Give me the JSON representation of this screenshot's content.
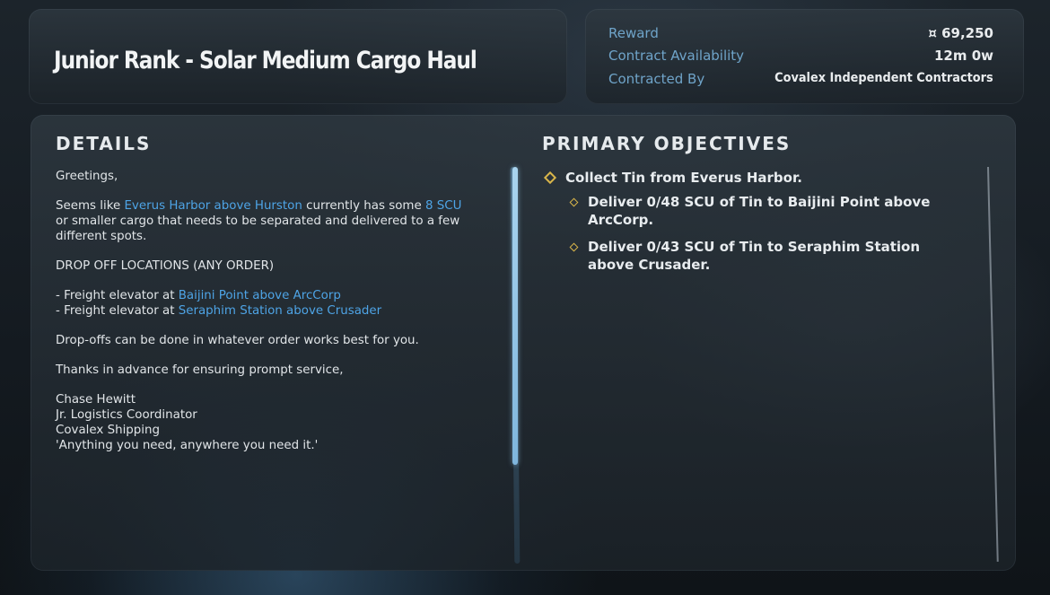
{
  "header": {
    "title": "Junior Rank - Solar Medium Cargo Haul"
  },
  "info": {
    "reward_label": "Reward",
    "reward_value": "¤ 69,250",
    "availability_label": "Contract Availability",
    "availability_value": "12m 0w",
    "contracted_by_label": "Contracted By",
    "contracted_by_value": "Covalex Independent Contractors"
  },
  "details": {
    "title": "DETAILS",
    "greeting": "Greetings,",
    "p1_a": "Seems like ",
    "p1_link1": "Everus Harbor above Hurston",
    "p1_b": " currently has some ",
    "p1_link2": "8 SCU",
    "p1_c": " or smaller cargo that needs to be separated and delivered to a few different spots.",
    "dropoff_header": "DROP OFF LOCATIONS (ANY ORDER)",
    "loc1_prefix": "- Freight elevator at ",
    "loc1_link": "Baijini Point above ArcCorp",
    "loc2_prefix": "- Freight elevator at ",
    "loc2_link": "Seraphim Station above Crusader",
    "order_note": "Drop-offs can be done in whatever order works best for you.",
    "thanks": "Thanks in advance for ensuring prompt service,",
    "sig_name": "Chase Hewitt",
    "sig_title": "Jr. Logistics Coordinator",
    "sig_company": "Covalex Shipping",
    "sig_motto": "'Anything you need, anywhere you need it.'"
  },
  "objectives": {
    "title": "PRIMARY OBJECTIVES",
    "primary": "Collect Tin from Everus Harbor.",
    "sub1": "Deliver 0/48 SCU of Tin to Baijini Point above ArcCorp.",
    "sub2": "Deliver 0/43 SCU of Tin to Seraphim Station above Crusader."
  },
  "colors": {
    "link": "#4ea4e6",
    "label": "#6fa4c9",
    "diamond": "#d8b54a"
  },
  "icons": {
    "objective_marker": "diamond-icon",
    "currency": "auec-currency-icon"
  }
}
